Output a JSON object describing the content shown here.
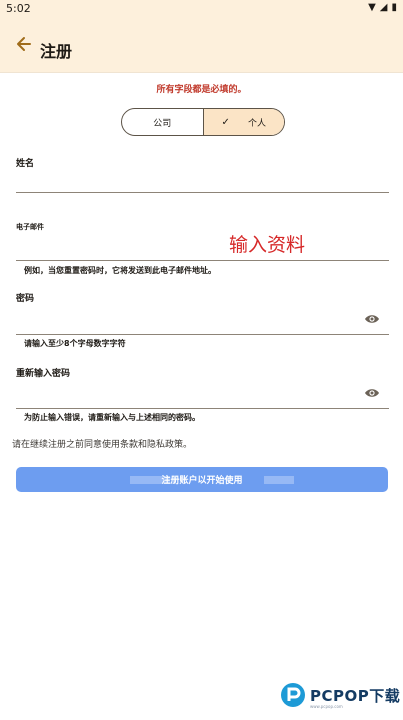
{
  "status_bar": {
    "time": "5:02"
  },
  "app_bar": {
    "title": "注册"
  },
  "form": {
    "required_note": "所有字段都是必填的。",
    "account_type": {
      "options": [
        "公司",
        "个人"
      ],
      "selected": "个人"
    },
    "name": {
      "label": "姓名",
      "value": ""
    },
    "email": {
      "label": "电子邮件",
      "value": "",
      "helper": "例如，当您重置密码时，它将发送到此电子邮件地址。"
    },
    "password": {
      "label": "密码",
      "value": "",
      "helper": "请输入至少8个字母数字字符"
    },
    "password_confirm": {
      "label": "重新输入密码",
      "value": "",
      "helper": "为防止输入错误，请重新输入与上述相同的密码。"
    },
    "terms_text": "请在继续注册之前同意使用条款和隐私政策。",
    "submit_label": "注册账户以开始使用"
  },
  "overlay_text": "输入资料",
  "watermark": {
    "brand": "PCPOP下载",
    "tagline": "www.pcpop.com"
  },
  "colors": {
    "header_bg": "#fdf0dc",
    "accent": "#6d9df0",
    "required_red": "#c0392b",
    "selected_segment": "#fbe4c6"
  }
}
